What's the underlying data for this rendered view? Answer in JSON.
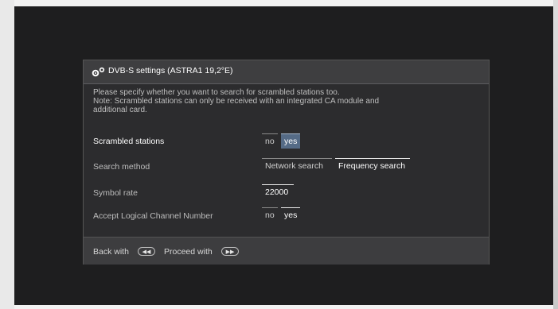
{
  "dialog": {
    "title": "DVB-S settings (ASTRA1 19,2°E)",
    "message_line1": "Please specify whether you want to search for scrambled stations too.",
    "message_line2": "Note: Scrambled stations can only be received with an integrated CA module and",
    "message_line3": "additional card."
  },
  "rows": {
    "scrambled": {
      "label": "Scrambled stations",
      "opt_no": "no",
      "opt_yes": "yes"
    },
    "search_method": {
      "label": "Search method",
      "opt_network": "Network search",
      "opt_frequency": "Frequency search"
    },
    "symbol_rate": {
      "label": "Symbol rate",
      "value": "22000"
    },
    "lcn": {
      "label": "Accept Logical Channel Number",
      "opt_no": "no",
      "opt_yes": "yes"
    }
  },
  "footer": {
    "back_label": "Back with",
    "back_icon": "rewind-icon",
    "proceed_label": "Proceed with",
    "proceed_icon": "fast-forward-icon"
  },
  "colors": {
    "screen_bg": "#1e1e1f",
    "dialog_bg": "#2c2c2e",
    "highlight": "#556b86"
  }
}
